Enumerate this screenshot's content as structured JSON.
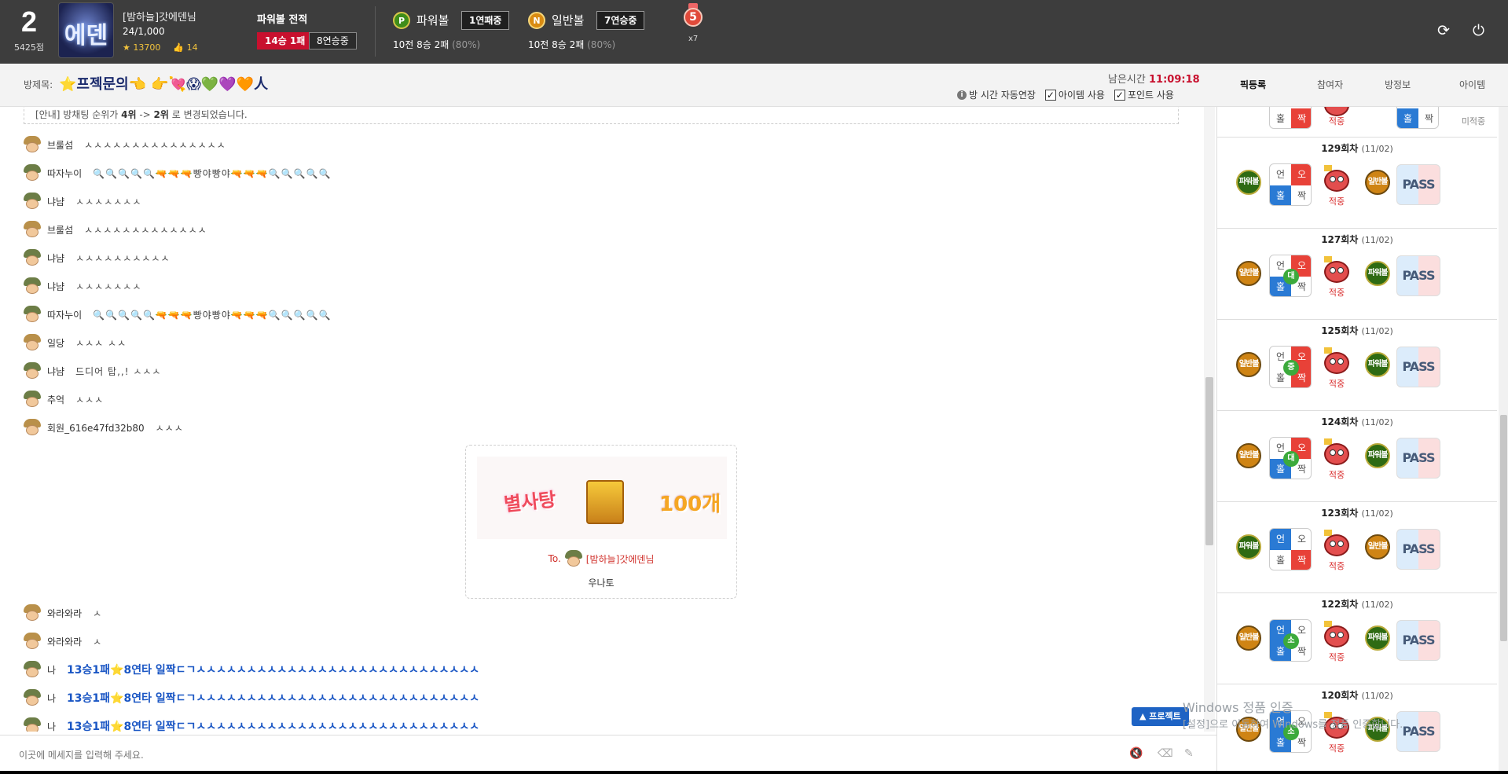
{
  "header": {
    "rank": "2",
    "points": "5425점",
    "avatar_text": "에덴",
    "username": "[밤하늘]갓에덴님",
    "count": "24/1,000",
    "stars": "13700",
    "likes": "14",
    "record_title": "파워볼 전적",
    "record_wl": "14승 1패",
    "record_streak": "8연승중",
    "powerball": {
      "icon": "P",
      "label": "파워볼",
      "badge": "1연패중",
      "sub": "10전 8승 2패",
      "pct": "(80%)"
    },
    "normalball": {
      "icon": "N",
      "label": "일반볼",
      "badge": "7연승중",
      "sub": "10전 8승 2패",
      "pct": "(80%)"
    },
    "medal_num": "5",
    "medal_x": "x7",
    "refresh_icon": "refresh-icon",
    "power_icon": "power-icon"
  },
  "room": {
    "label": "방제목:",
    "title": "⭐프젝문의👈 👉💘😱💚💜🧡人",
    "timer_label": "남은시간",
    "timer_value": "11:09:18",
    "opt_extend": "방 시간 자동연장",
    "opt_item": "아이템 사용",
    "opt_point": "포인트 사용"
  },
  "tabs": [
    "픽등록",
    "참여자",
    "방정보",
    "아이템"
  ],
  "notice": {
    "prefix": "[안내] 방채팅 순위가 ",
    "from": "4위",
    "mid": " -> ",
    "to": "2위",
    "suffix": " 로 변경되었습니다."
  },
  "messages": [
    {
      "name": "브룰섬",
      "text": "ㅅㅅㅅㅅㅅㅅㅅㅅㅅㅅㅅㅅㅅㅅㅅ",
      "gold": true
    },
    {
      "name": "따자누이",
      "text": "🔍🔍🔍🔍🔍🔫🔫🔫빵야빵야🔫🔫🔫🔍🔍🔍🔍🔍",
      "gold": false
    },
    {
      "name": "냐냠",
      "text": "ㅅㅅㅅㅅㅅㅅㅅ",
      "gold": false
    },
    {
      "name": "브룰섬",
      "text": "ㅅㅅㅅㅅㅅㅅㅅㅅㅅㅅㅅㅅㅅ",
      "gold": true
    },
    {
      "name": "냐냠",
      "text": "ㅅㅅㅅㅅㅅㅅㅅㅅㅅㅅ",
      "gold": false
    },
    {
      "name": "냐냠",
      "text": "ㅅㅅㅅㅅㅅㅅㅅ",
      "gold": false
    },
    {
      "name": "따자누이",
      "text": "🔍🔍🔍🔍🔍🔫🔫🔫빵야빵야🔫🔫🔫🔍🔍🔍🔍🔍",
      "gold": false
    },
    {
      "name": "일당",
      "text": "ㅅㅅㅅ ㅅㅅ",
      "gold": true
    },
    {
      "name": "냐냠",
      "text": "드디어 탑,,! ㅅㅅㅅ",
      "gold": false
    },
    {
      "name": "추억",
      "text": "ㅅㅅㅅ",
      "gold": false
    },
    {
      "name": "회원_616e47fd32b80",
      "text": "ㅅㅅㅅ",
      "gold": true
    }
  ],
  "gift": {
    "item": "별사탕",
    "count": "100개",
    "to_prefix": "To.",
    "to_name": "[밤하늘]갓에덴님",
    "from": "우나토"
  },
  "messages2": [
    {
      "name": "와라와라",
      "text": "ㅅ",
      "gold": true,
      "blue": false
    },
    {
      "name": "와라와라",
      "text": "ㅅ",
      "gold": true,
      "blue": false
    },
    {
      "name": "나",
      "text": "13승1패⭐8연타 일짝ㄷㄱㅅㅅㅅㅅㅅㅅㅅㅅㅅㅅㅅㅅㅅㅅㅅㅅㅅㅅㅅㅅㅅㅅㅅㅅㅅㅅㅅㅅ",
      "gold": false,
      "blue": true
    },
    {
      "name": "나",
      "text": "13승1패⭐8연타 일짝ㄷㄱㅅㅅㅅㅅㅅㅅㅅㅅㅅㅅㅅㅅㅅㅅㅅㅅㅅㅅㅅㅅㅅㅅㅅㅅㅅㅅㅅㅅ",
      "gold": false,
      "blue": true
    },
    {
      "name": "나",
      "text": "13승1패⭐8연타 일짝ㄷㄱㅅㅅㅅㅅㅅㅅㅅㅅㅅㅅㅅㅅㅅㅅㅅㅅㅅㅅㅅㅅㅅㅅㅅㅅㅅㅅㅅㅅ",
      "gold": false,
      "blue": true
    }
  ],
  "expand_label": "▲ 프로젝트",
  "input": {
    "placeholder": "이곳에 메세지를 입력해 주세요."
  },
  "rounds": [
    {
      "title": "129회차",
      "date": "(11/02)",
      "ball1": "파워볼",
      "ball1_type": "pw",
      "ball2": "일반볼",
      "ball2_type": "nm",
      "on": [
        "tr",
        "bl"
      ],
      "mid": "",
      "hit": "적중",
      "pass": "PASS"
    },
    {
      "title": "127회차",
      "date": "(11/02)",
      "ball1": "일반볼",
      "ball1_type": "nm",
      "ball2": "파워볼",
      "ball2_type": "pw",
      "on": [
        "tr",
        "bl"
      ],
      "mid": "대",
      "hit": "적중",
      "pass": "PASS"
    },
    {
      "title": "125회차",
      "date": "(11/02)",
      "ball1": "일반볼",
      "ball1_type": "nm",
      "ball2": "파워볼",
      "ball2_type": "pw",
      "on": [
        "tr",
        "br"
      ],
      "mid": "중",
      "hit": "적중",
      "pass": "PASS"
    },
    {
      "title": "124회차",
      "date": "(11/02)",
      "ball1": "일반볼",
      "ball1_type": "nm",
      "ball2": "파워볼",
      "ball2_type": "pw",
      "on": [
        "tr",
        "bl"
      ],
      "mid": "대",
      "hit": "적중",
      "pass": "PASS"
    },
    {
      "title": "123회차",
      "date": "(11/02)",
      "ball1": "파워볼",
      "ball1_type": "pw",
      "ball2": "일반볼",
      "ball2_type": "nm",
      "on": [
        "tl",
        "br"
      ],
      "mid": "",
      "hit": "적중",
      "pass": "PASS"
    },
    {
      "title": "122회차",
      "date": "(11/02)",
      "ball1": "일반볼",
      "ball1_type": "nm",
      "ball2": "파워볼",
      "ball2_type": "pw",
      "on": [
        "tl",
        "bl"
      ],
      "mid": "소",
      "hit": "적중",
      "pass": "PASS"
    },
    {
      "title": "120회차",
      "date": "(11/02)",
      "ball1": "일반볼",
      "ball1_type": "nm",
      "ball2": "파워볼",
      "ball2_type": "pw",
      "on": [
        "tl",
        "bl"
      ],
      "mid": "소",
      "hit": "적중",
      "pass": "PASS"
    }
  ],
  "top_partial": {
    "hit1": "적중",
    "hit2": "미적중",
    "cell_home": "홀",
    "cell_even": "짝"
  },
  "grid_labels": {
    "tl": "언",
    "tr": "오",
    "bl": "홀",
    "br": "짝"
  },
  "watermark": {
    "line1": "Windows 정품 인증",
    "line2": "[설정]으로 이동하여 Windows를 정품 인증합니다."
  }
}
